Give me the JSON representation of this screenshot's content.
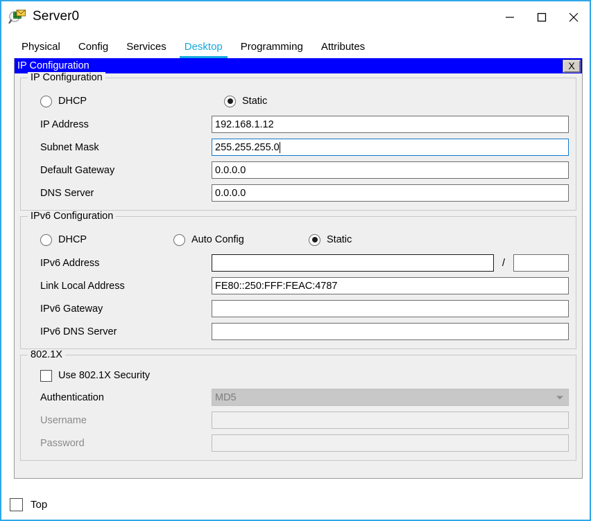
{
  "window": {
    "title": "Server0",
    "icon": "server-magnifier-icon",
    "minimize_label": "—",
    "maximize_label": "□",
    "close_label": "✕",
    "border_color": "#2ea7e8"
  },
  "tabs": [
    {
      "label": "Physical",
      "active": false
    },
    {
      "label": "Config",
      "active": false
    },
    {
      "label": "Services",
      "active": false
    },
    {
      "label": "Desktop",
      "active": true
    },
    {
      "label": "Programming",
      "active": false
    },
    {
      "label": "Attributes",
      "active": false
    }
  ],
  "tab_accent_color": "#17a7dd",
  "dialog": {
    "title": "IP Configuration",
    "titlebar_color": "#0000ff",
    "close_label": "X",
    "ipv4": {
      "legend": "IP Configuration",
      "dhcp_label": "DHCP",
      "dhcp_selected": false,
      "static_label": "Static",
      "static_selected": true,
      "fields": [
        {
          "label": "IP Address",
          "value": "192.168.1.12",
          "focused": false
        },
        {
          "label": "Subnet Mask",
          "value": "255.255.255.0",
          "focused": true
        },
        {
          "label": "Default Gateway",
          "value": "0.0.0.0",
          "focused": false
        },
        {
          "label": "DNS Server",
          "value": "0.0.0.0",
          "focused": false
        }
      ]
    },
    "ipv6": {
      "legend": "IPv6 Configuration",
      "dhcp_label": "DHCP",
      "dhcp_selected": false,
      "autoconfig_label": "Auto Config",
      "autoconfig_selected": false,
      "static_label": "Static",
      "static_selected": true,
      "address_label": "IPv6 Address",
      "address_value": "",
      "prefix_separator": "/",
      "prefix_value": "",
      "fields": [
        {
          "label": "Link Local Address",
          "value": "FE80::250:FFF:FEAC:4787"
        },
        {
          "label": "IPv6 Gateway",
          "value": ""
        },
        {
          "label": "IPv6 DNS Server",
          "value": ""
        }
      ]
    },
    "dot1x": {
      "legend": "802.1X",
      "use_label": "Use 802.1X Security",
      "use_checked": false,
      "auth_label": "Authentication",
      "auth_value": "MD5",
      "username_label": "Username",
      "username_value": "",
      "password_label": "Password",
      "password_value": ""
    }
  },
  "bottom": {
    "top_label": "Top",
    "top_checked": false
  }
}
